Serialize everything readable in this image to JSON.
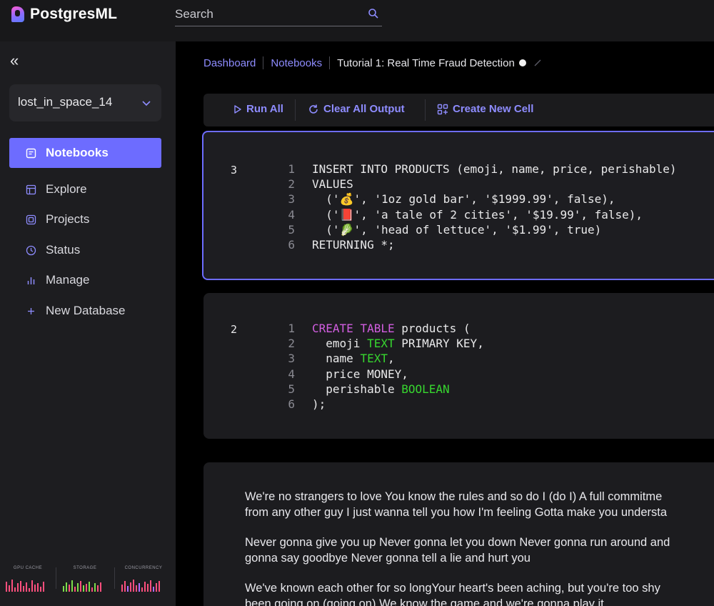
{
  "app": {
    "name": "PostgresML"
  },
  "search": {
    "placeholder": "Search"
  },
  "sidebar": {
    "collapse_label": "«",
    "database": "lost_in_space_14",
    "items": [
      {
        "label": "Notebooks",
        "icon": "notebook-icon",
        "active": true
      },
      {
        "label": "Explore",
        "icon": "explore-icon"
      },
      {
        "label": "Projects",
        "icon": "projects-icon"
      },
      {
        "label": "Status",
        "icon": "status-icon"
      },
      {
        "label": "Manage",
        "icon": "manage-icon"
      },
      {
        "label": "New Database",
        "icon": "plus-icon"
      }
    ],
    "metrics": [
      {
        "label": "GPU CACHE"
      },
      {
        "label": "STORAGE"
      },
      {
        "label": "CONCURRENCY"
      }
    ]
  },
  "breadcrumb": {
    "items": [
      "Dashboard",
      "Notebooks"
    ],
    "current": "Tutorial 1: Real Time Fraud Detection"
  },
  "toolbar": {
    "run_all": "Run All",
    "clear_output": "Clear All Output",
    "create_cell": "Create New Cell"
  },
  "cells": [
    {
      "number": "3",
      "lines": [
        "INSERT INTO PRODUCTS (emoji, name, price, perishable)",
        "VALUES",
        "  ('💰', '1oz gold bar', '$1999.99', false),",
        "  ('📕', 'a tale of 2 cities', '$19.99', false),",
        "  ('🥬', 'head of lettuce', '$1.99', true)",
        "RETURNING *;"
      ]
    },
    {
      "number": "2",
      "lines": [
        "CREATE TABLE products (",
        "  emoji TEXT PRIMARY KEY,",
        "  name TEXT,",
        "  price MONEY,",
        "  perishable BOOLEAN",
        ");"
      ]
    }
  ],
  "markdown": {
    "paragraphs": [
      "We're no strangers to love You know the rules and so do I (do I) A full commitme",
      "from any other guy I just wanna tell you how I'm feeling Gotta make you understa",
      "Never gonna give you up Never gonna let you down Never gonna run around and",
      "gonna say goodbye Never gonna tell a lie and hurt you",
      "We've known each other for so longYour heart's been aching, but you're too shy",
      "been going on (going on) We know the game and we're gonna play it"
    ]
  }
}
